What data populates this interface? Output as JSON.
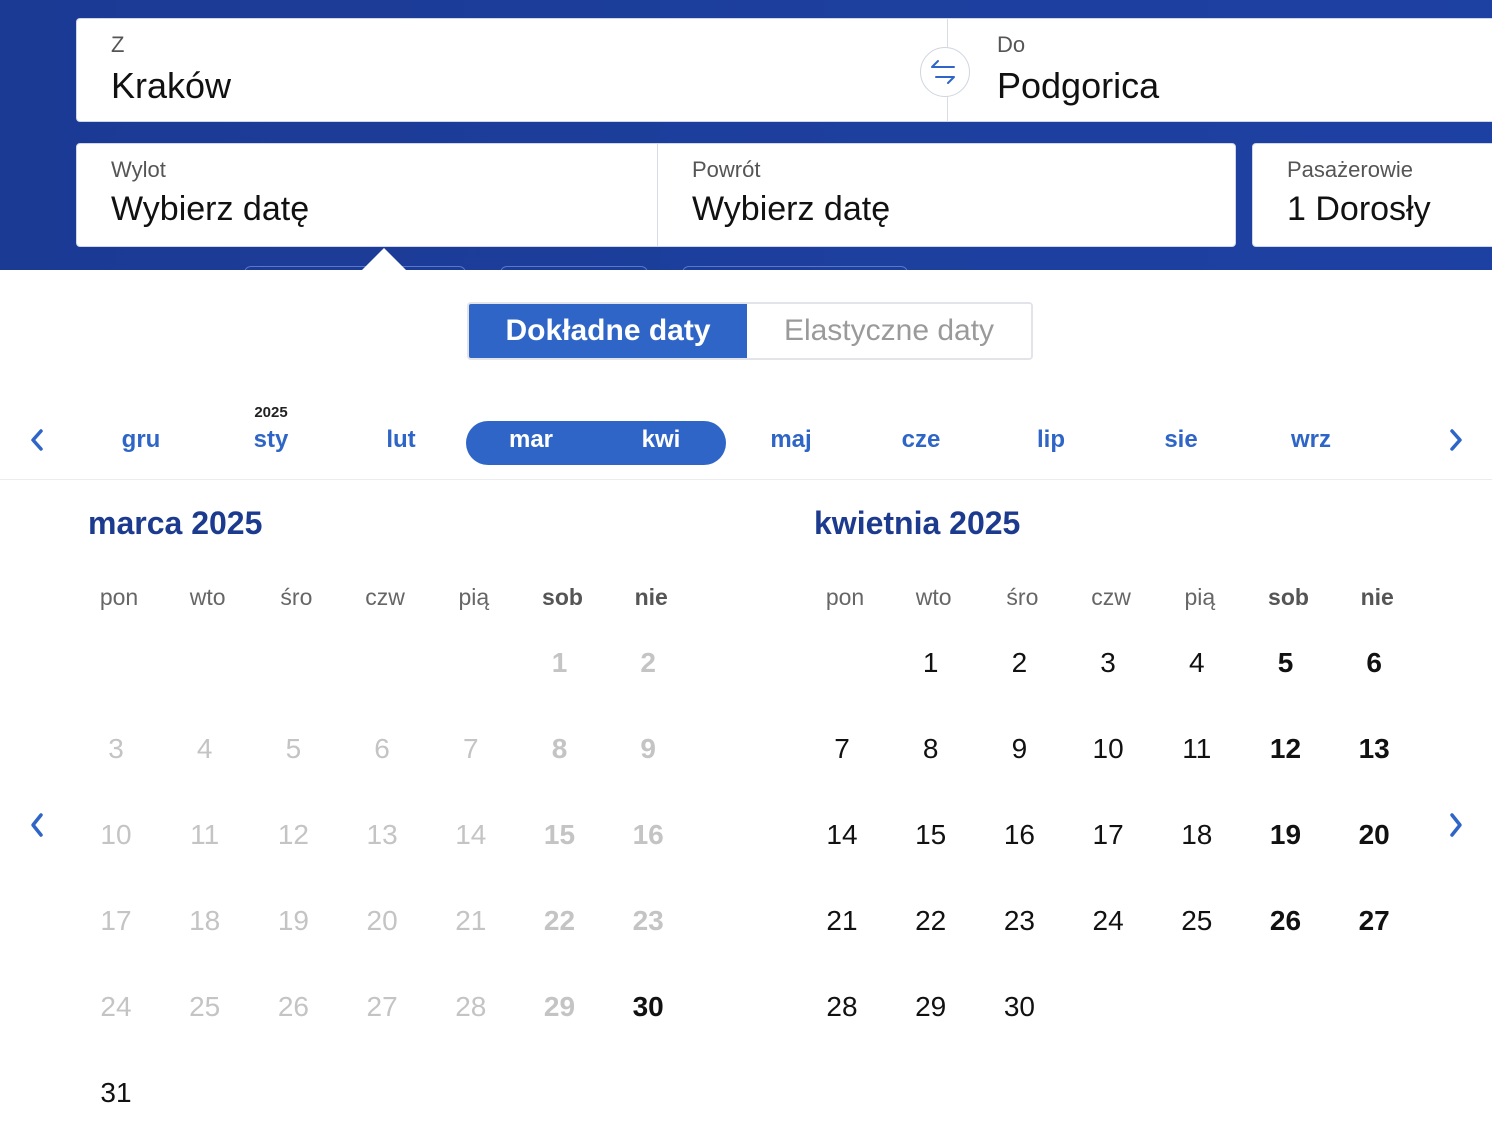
{
  "search": {
    "from_label": "Z",
    "from_value": "Kraków",
    "to_label": "Do",
    "to_value": "Podgorica",
    "depart_label": "Wylot",
    "depart_value": "Wybierz datę",
    "return_label": "Powrót",
    "return_value": "Wybierz datę",
    "pax_label": "Pasażerowie",
    "pax_value": "1 Dorosły"
  },
  "toggle": {
    "exact": "Dokładne daty",
    "flexible": "Elastyczne daty"
  },
  "month_strip": {
    "year_marker": "2025",
    "months": [
      "gru",
      "sty",
      "lut",
      "mar",
      "kwi",
      "maj",
      "cze",
      "lip",
      "sie",
      "wrz"
    ],
    "selected": [
      "mar",
      "kwi"
    ]
  },
  "weekdays": [
    "pon",
    "wto",
    "śro",
    "czw",
    "pią",
    "sob",
    "nie"
  ],
  "calendars": [
    {
      "title": "marca 2025",
      "first_weekday_index": 5,
      "days": 31,
      "past_until": 29
    },
    {
      "title": "kwietnia 2025",
      "first_weekday_index": 1,
      "days": 30,
      "past_until": 0
    }
  ],
  "colors": {
    "brand_dark": "#1b3a94",
    "accent": "#2e65c6",
    "title": "#1c3a8e"
  },
  "icons": {
    "swap": "swap-arrows-icon",
    "prev": "chevron-left-icon",
    "next": "chevron-right-icon"
  }
}
